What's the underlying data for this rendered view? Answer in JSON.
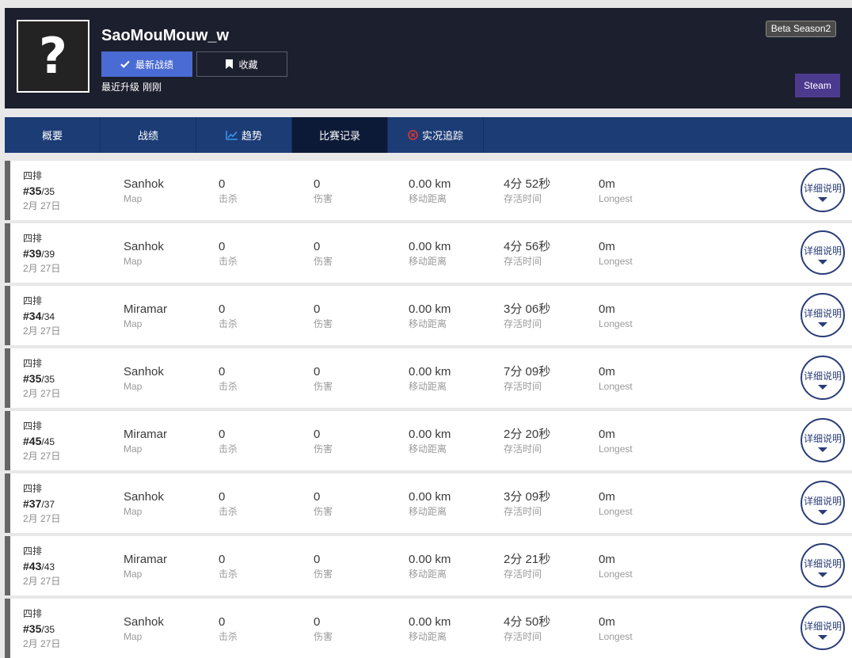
{
  "colors": {
    "header_bg": "#1c1f2d",
    "nav_bg": "#1c3c76",
    "nav_active_bg": "#0d1a37",
    "primary": "#4a6bd3",
    "steam": "#4c3a8f",
    "detail": "#2a3d78",
    "row_accent": "#666666",
    "page_bg": "#e8e8e8"
  },
  "header": {
    "avatar_placeholder": "?",
    "player_name": "SaoMouMouw_w",
    "buttons": {
      "latest_matches": {
        "label": "最新战绩",
        "icon": "check-icon"
      },
      "favorite": {
        "label": "收藏",
        "icon": "bookmark-icon"
      },
      "steam": {
        "label": "Steam"
      }
    },
    "last_update_label": "最近升级",
    "last_update_value": "刚刚",
    "season_badge": "Beta Season2"
  },
  "nav": {
    "tabs": [
      {
        "label": "概要"
      },
      {
        "label": "战绩"
      },
      {
        "label": "趋势",
        "icon": "trend-chart-icon"
      },
      {
        "label": "比赛记录",
        "active": true
      },
      {
        "label": "实况追踪",
        "icon": "live-tracking-icon"
      }
    ]
  },
  "match_labels": {
    "map": "Map",
    "kills": "击杀",
    "damage": "伤害",
    "distance": "移动距离",
    "survival": "存活时间",
    "longest": "Longest",
    "detail_button": "详细说明"
  },
  "matches": [
    {
      "mode": "四排",
      "rank": "#35",
      "total": "/35",
      "date": "2月 27日",
      "map": "Sanhok",
      "kills": "0",
      "damage": "0",
      "distance": "0.00 km",
      "survival": "4分 52秒",
      "longest": "0m"
    },
    {
      "mode": "四排",
      "rank": "#39",
      "total": "/39",
      "date": "2月 27日",
      "map": "Sanhok",
      "kills": "0",
      "damage": "0",
      "distance": "0.00 km",
      "survival": "4分 56秒",
      "longest": "0m"
    },
    {
      "mode": "四排",
      "rank": "#34",
      "total": "/34",
      "date": "2月 27日",
      "map": "Miramar",
      "kills": "0",
      "damage": "0",
      "distance": "0.00 km",
      "survival": "3分 06秒",
      "longest": "0m"
    },
    {
      "mode": "四排",
      "rank": "#35",
      "total": "/35",
      "date": "2月 27日",
      "map": "Sanhok",
      "kills": "0",
      "damage": "0",
      "distance": "0.00 km",
      "survival": "7分 09秒",
      "longest": "0m"
    },
    {
      "mode": "四排",
      "rank": "#45",
      "total": "/45",
      "date": "2月 27日",
      "map": "Miramar",
      "kills": "0",
      "damage": "0",
      "distance": "0.00 km",
      "survival": "2分 20秒",
      "longest": "0m"
    },
    {
      "mode": "四排",
      "rank": "#37",
      "total": "/37",
      "date": "2月 27日",
      "map": "Sanhok",
      "kills": "0",
      "damage": "0",
      "distance": "0.00 km",
      "survival": "3分 09秒",
      "longest": "0m"
    },
    {
      "mode": "四排",
      "rank": "#43",
      "total": "/43",
      "date": "2月 27日",
      "map": "Miramar",
      "kills": "0",
      "damage": "0",
      "distance": "0.00 km",
      "survival": "2分 21秒",
      "longest": "0m"
    },
    {
      "mode": "四排",
      "rank": "#35",
      "total": "/35",
      "date": "2月 27日",
      "map": "Sanhok",
      "kills": "0",
      "damage": "0",
      "distance": "0.00 km",
      "survival": "4分 50秒",
      "longest": "0m"
    }
  ]
}
